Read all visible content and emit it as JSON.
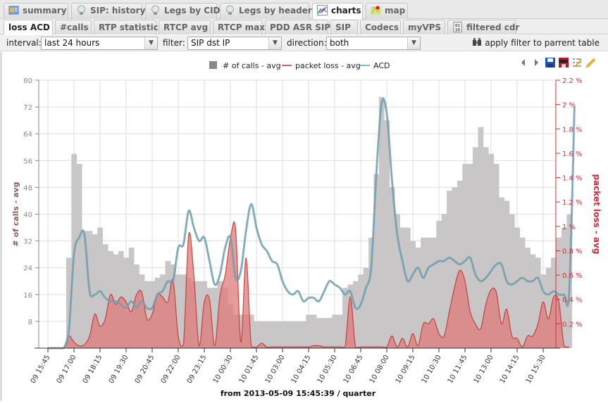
{
  "tabs_top": [
    {
      "label": "summary",
      "icon": "summary-icon"
    },
    {
      "label": "SIP: history",
      "icon": "bulb-icon"
    },
    {
      "label": "Legs by CID",
      "icon": "bulb-icon"
    },
    {
      "label": "Legs by header",
      "icon": "bulb-icon"
    },
    {
      "label": "charts",
      "icon": "chart-icon",
      "active": true
    },
    {
      "label": "map",
      "icon": "map-icon"
    }
  ],
  "tabs_sub": [
    {
      "label": "loss ACD",
      "active": true
    },
    {
      "label": "#calls"
    },
    {
      "label": "RTP statistic"
    },
    {
      "label": "RTCP avg"
    },
    {
      "label": "RTCP max"
    },
    {
      "label": "PDD ASR SIP"
    },
    {
      "label": "SIP"
    },
    {
      "label": "Codecs"
    },
    {
      "label": "myVPS"
    },
    {
      "label": "filtered cdr",
      "icon": "binary-file-icon"
    }
  ],
  "filters": {
    "interval_label": "interval:",
    "interval_value": "last 24 hours",
    "filter_label": "filter:",
    "filter_value": "SIP dst IP",
    "direction_label": "direction:",
    "direction_value": "both",
    "apply_label": "apply filter to parrent table"
  },
  "toolbar_icons": [
    "prev-icon",
    "next-icon",
    "save-icon",
    "export-png-icon",
    "settings-list-icon",
    "edit-pencil-icon"
  ],
  "colors": {
    "calls": "#c8c6c6",
    "loss_line": "#c0312d",
    "loss_fill": "#e07a7a",
    "acd": "#4fa6c8",
    "right_axis": "#d62b3a"
  },
  "chart_data": {
    "type": "bar",
    "title": "",
    "xlabel": "from 2013-05-09 15:45:39 / quarter",
    "ylabel": "# of calls - avg",
    "y2label": "packet loss - avg",
    "ylim": [
      0,
      80
    ],
    "y2lim": [
      0,
      2.2
    ],
    "yticks": [
      8,
      16,
      24,
      32,
      40,
      48,
      56,
      64,
      72,
      80
    ],
    "y2ticks": [
      "0.2 %",
      "0.4 %",
      "0.6 %",
      "0.8 %",
      "1 %",
      "1.2 %",
      "1.4 %",
      "1.6 %",
      "1.8 %",
      "2 %",
      "2.2 %"
    ],
    "xticks": [
      "09 15:45",
      "09 17:00",
      "09 18:15",
      "09 19:30",
      "09 20:45",
      "09 22:00",
      "09 23:15",
      "10 00:30",
      "10 01:45",
      "10 03:00",
      "10 04:15",
      "10 05:30",
      "10 06:45",
      "10 08:00",
      "10 09:15",
      "10 10:30",
      "10 11:45",
      "10 13:00",
      "10 14:15",
      "10 15:30"
    ],
    "grid": true,
    "legend": "top-center",
    "legend_entries": [
      "# of calls - avg",
      "packet loss - avg",
      "ACD"
    ],
    "series": [
      {
        "name": "# of calls - avg",
        "type": "bar",
        "axis": "left",
        "values": [
          0,
          0,
          0,
          0,
          27,
          58,
          55,
          35,
          35,
          34,
          36,
          31,
          29,
          28,
          29,
          27,
          30,
          25,
          22,
          20,
          20,
          21,
          22,
          26,
          25,
          22,
          22,
          21,
          20,
          20,
          20,
          18,
          18,
          20,
          18,
          13,
          10,
          10,
          10,
          10,
          8,
          8,
          8,
          8,
          8,
          8,
          8,
          8,
          8,
          8,
          10,
          10,
          9,
          9,
          9,
          10,
          10,
          18,
          19,
          20,
          22,
          24,
          33,
          52,
          75,
          68,
          48,
          40,
          36,
          36,
          32,
          30,
          33,
          33,
          33,
          38,
          40,
          47,
          48,
          50,
          55,
          55,
          60,
          66,
          60,
          58,
          55,
          45,
          44,
          40,
          36,
          33,
          30,
          28,
          27,
          22,
          24,
          27,
          33,
          36,
          40
        ]
      },
      {
        "name": "packet loss - avg",
        "type": "area",
        "axis": "right",
        "values": [
          0,
          0,
          0,
          0,
          0.1,
          0.05,
          0.02,
          0.03,
          0.1,
          0.28,
          0.18,
          0.24,
          0.44,
          0.36,
          0.42,
          0.38,
          0.3,
          0.44,
          0.46,
          0.24,
          0.28,
          0.44,
          0.42,
          0.38,
          0.56,
          0.1,
          0.03,
          0.93,
          0.6,
          0.02,
          0.38,
          0.4,
          0.02,
          0.43,
          0.6,
          0.9,
          0.98,
          0.05,
          0.74,
          0.02,
          0.01,
          0.04,
          0.01,
          0.01,
          0.01,
          0.01,
          0.01,
          0.01,
          0.01,
          0.01,
          0.01,
          0.02,
          0.02,
          0.01,
          0.01,
          0.01,
          0.01,
          0.01,
          0.42,
          0.01,
          0.01,
          0.01,
          0.01,
          0.01,
          0.01,
          0.01,
          0.1,
          0.01,
          0.08,
          0.01,
          0.12,
          0.02,
          0.2,
          0.2,
          0.24,
          0.12,
          0.1,
          0.3,
          0.5,
          0.64,
          0.55,
          0.3,
          0.2,
          0.16,
          0.36,
          0.48,
          0.46,
          0.2,
          0.32,
          0.1,
          0.08,
          0.01,
          0.1,
          0.1,
          0.2,
          0.38,
          0.24,
          0.42,
          0.38,
          0.02,
          0.01
        ]
      },
      {
        "name": "ACD",
        "type": "line",
        "axis": "left",
        "values": [
          0,
          0,
          0,
          0,
          5,
          28,
          33,
          34,
          17,
          16,
          17,
          15,
          14,
          14,
          13,
          12,
          14,
          12,
          14,
          12,
          12,
          16,
          17,
          20,
          20,
          30,
          31,
          41,
          36,
          32,
          33,
          26,
          19,
          22,
          30,
          33,
          21,
          23,
          35,
          43,
          36,
          31,
          29,
          26,
          25,
          20,
          17,
          16,
          17,
          14,
          15,
          15,
          14,
          17,
          20,
          19,
          18,
          16,
          17,
          12,
          13,
          18,
          24,
          52,
          73,
          70,
          50,
          34,
          26,
          20,
          22,
          24,
          21,
          24,
          25,
          26,
          26,
          27,
          26,
          25,
          26,
          27,
          22,
          20,
          21,
          23,
          25,
          25,
          20,
          19,
          20,
          21,
          20,
          20,
          21,
          17,
          16,
          17,
          16,
          16,
          17,
          72
        ]
      }
    ]
  }
}
